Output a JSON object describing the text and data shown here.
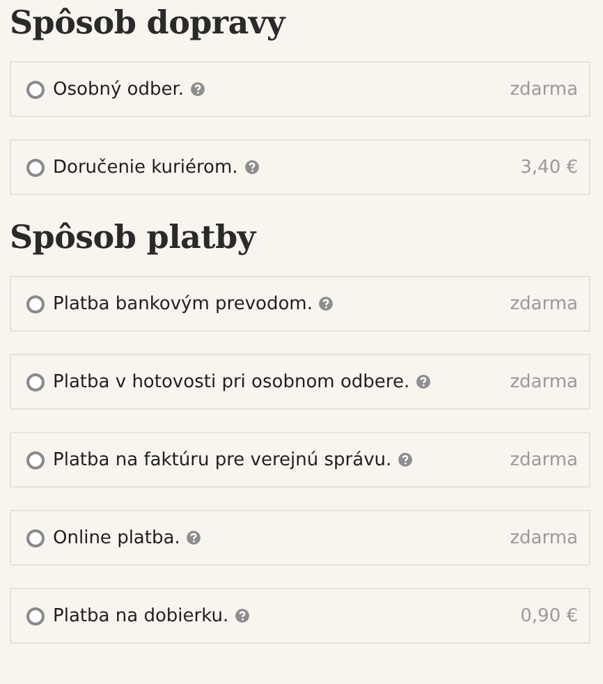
{
  "sections": [
    {
      "title": "Spôsob dopravy",
      "options": [
        {
          "label": "Osobný odber.",
          "price": "zdarma",
          "selected": false
        },
        {
          "label": "Doručenie kuriérom.",
          "price": "3,40 €",
          "selected": false
        }
      ]
    },
    {
      "title": "Spôsob platby",
      "options": [
        {
          "label": "Platba bankovým prevodom.",
          "price": "zdarma",
          "selected": false
        },
        {
          "label": "Platba v hotovosti pri osobnom odbere.",
          "price": "zdarma",
          "selected": false
        },
        {
          "label": "Platba na faktúru pre verejnú správu.",
          "price": "zdarma",
          "selected": false
        },
        {
          "label": "Online platba.",
          "price": "zdarma",
          "selected": false
        },
        {
          "label": "Platba na dobierku.",
          "price": "0,90 €",
          "selected": false
        }
      ]
    }
  ]
}
